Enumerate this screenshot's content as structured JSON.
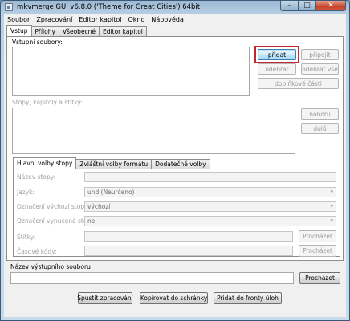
{
  "window": {
    "title": "mkvmerge GUI v6.8.0 ('Theme for Great Cities') 64bit",
    "controls": {
      "minimize": "–",
      "maximize": "□",
      "close": "✕"
    }
  },
  "menu": [
    "Soubor",
    "Zpracování",
    "Editor kapitol",
    "Okno",
    "Nápověda"
  ],
  "main_tabs": [
    "Vstup",
    "Přílohy",
    "Všeobecné",
    "Editor kapitol"
  ],
  "input": {
    "files_label": "Vstupní soubory:",
    "add": "přidat",
    "append": "připojit",
    "remove": "odebrat",
    "remove_all": "odebrat vše",
    "additional_parts": "doplňkové části",
    "tracks_label": "Stopy, kapitoly a štítky:",
    "up": "nahoru",
    "down": "dolů"
  },
  "sub_tabs": [
    "Hlavní volby stopy",
    "Zvláštní volby formátu",
    "Dodatečné volby"
  ],
  "track_options": {
    "name_label": "Název stopy:",
    "language_label": "Jazyk:",
    "language_value": "und (Neurčeno)",
    "default_track_label": "Označení výchozí stopy:",
    "default_track_value": "výchozí",
    "forced_track_label": "Označení vynucené stopy:",
    "forced_track_value": "ne",
    "tags_label": "Štítky:",
    "tags_browse": "Procházet",
    "timecodes_label": "Časové kódy:",
    "timecodes_browse": "Procházet"
  },
  "output": {
    "label": "Název výstupního souboru",
    "value": "",
    "browse": "Procházet"
  },
  "actions": {
    "start": "Spustit zpracování",
    "copy": "Kopírovat do schránky",
    "queue": "Přidat do fronty úloh"
  }
}
